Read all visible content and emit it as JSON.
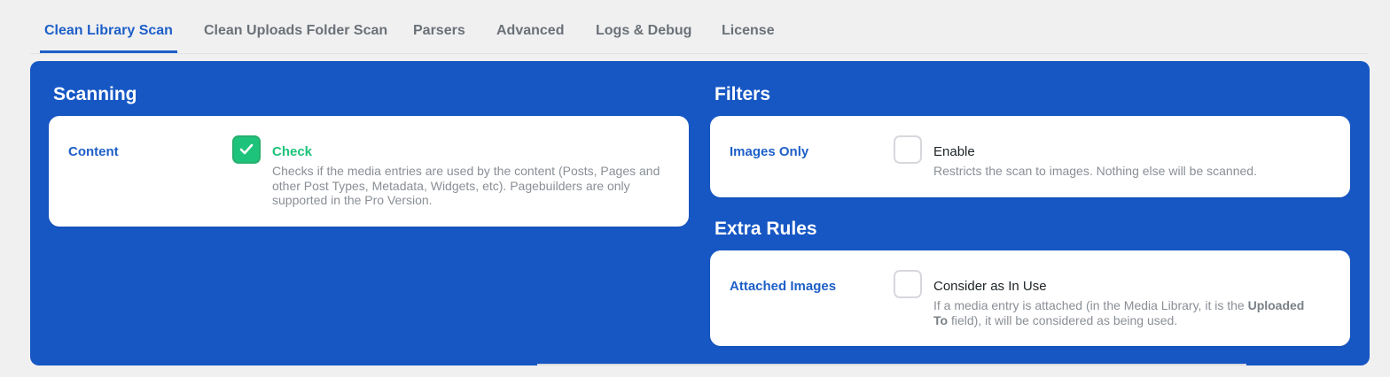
{
  "tabs": [
    {
      "label": "Clean Library Scan",
      "active": true
    },
    {
      "label": "Clean Uploads Folder Scan",
      "active": false
    },
    {
      "label": "Parsers",
      "active": false
    },
    {
      "label": "Advanced",
      "active": false
    },
    {
      "label": "Logs & Debug",
      "active": false
    },
    {
      "label": "License",
      "active": false
    }
  ],
  "colors": {
    "accent": "#1e5fc7",
    "panel": "#1657c4",
    "checked": "#1dc37a"
  },
  "scanning": {
    "title": "Scanning",
    "content": {
      "label": "Content",
      "checked": true,
      "option": "Check",
      "description": "Checks if the media entries are used by the content (Posts, Pages and other Post Types, Metadata, Widgets, etc). Pagebuilders are only supported in the Pro Version."
    }
  },
  "filters": {
    "title": "Filters",
    "images_only": {
      "label": "Images Only",
      "checked": false,
      "option": "Enable",
      "description": "Restricts the scan to images. Nothing else will be scanned."
    }
  },
  "extra_rules": {
    "title": "Extra Rules",
    "attached_images": {
      "label": "Attached Images",
      "checked": false,
      "option": "Consider as In Use",
      "description_prefix": "If a media entry is attached (in the Media Library, it is the ",
      "description_bold": "Uploaded To",
      "description_suffix": " field), it will be considered as being used."
    }
  }
}
